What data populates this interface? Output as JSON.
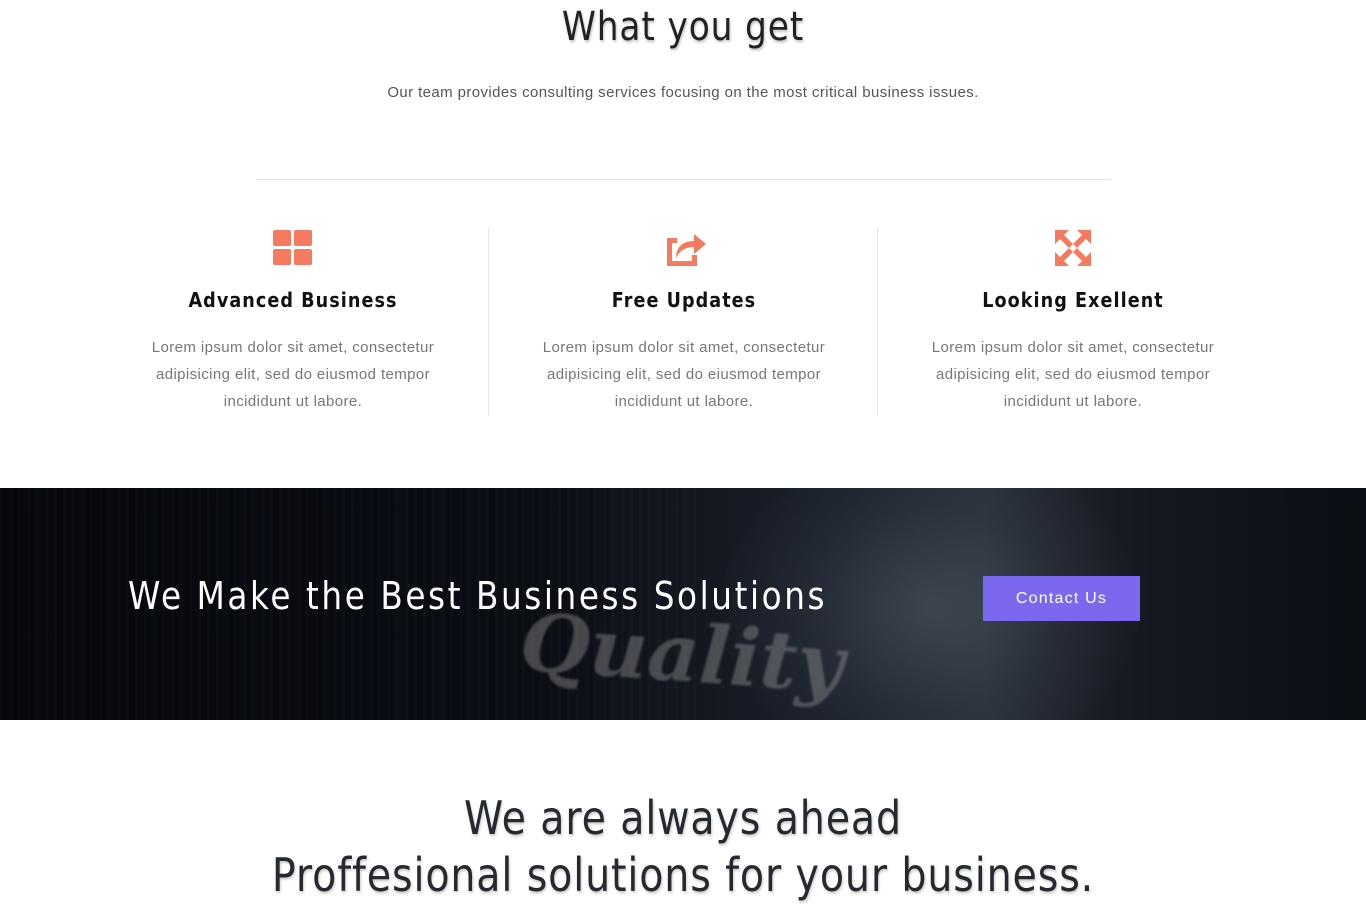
{
  "intro": {
    "title": "What you get",
    "subtitle": "Our team provides consulting services focusing on the most critical business issues."
  },
  "features": [
    {
      "icon": "grid-icon",
      "title": "Advanced Business",
      "description": "Lorem ipsum dolor sit amet, consectetur adipisicing elit, sed do eiusmod tempor incididunt ut labore."
    },
    {
      "icon": "share-icon",
      "title": "Free Updates",
      "description": "Lorem ipsum dolor sit amet, consectetur adipisicing elit, sed do eiusmod tempor incididunt ut labore."
    },
    {
      "icon": "expand-arrows-icon",
      "title": "Looking Exellent",
      "description": "Lorem ipsum dolor sit amet, consectetur adipisicing elit, sed do eiusmod tempor incididunt ut labore."
    }
  ],
  "banner": {
    "headline": "We Make the Best Business Solutions",
    "button_label": "Contact Us",
    "button_color": "#7b68ee",
    "background_text": "Quality"
  },
  "ahead": {
    "line1": "We are always ahead",
    "line2": "Proffesional solutions for your business."
  },
  "colors": {
    "accent": "#f47a60",
    "button": "#7b68ee"
  }
}
